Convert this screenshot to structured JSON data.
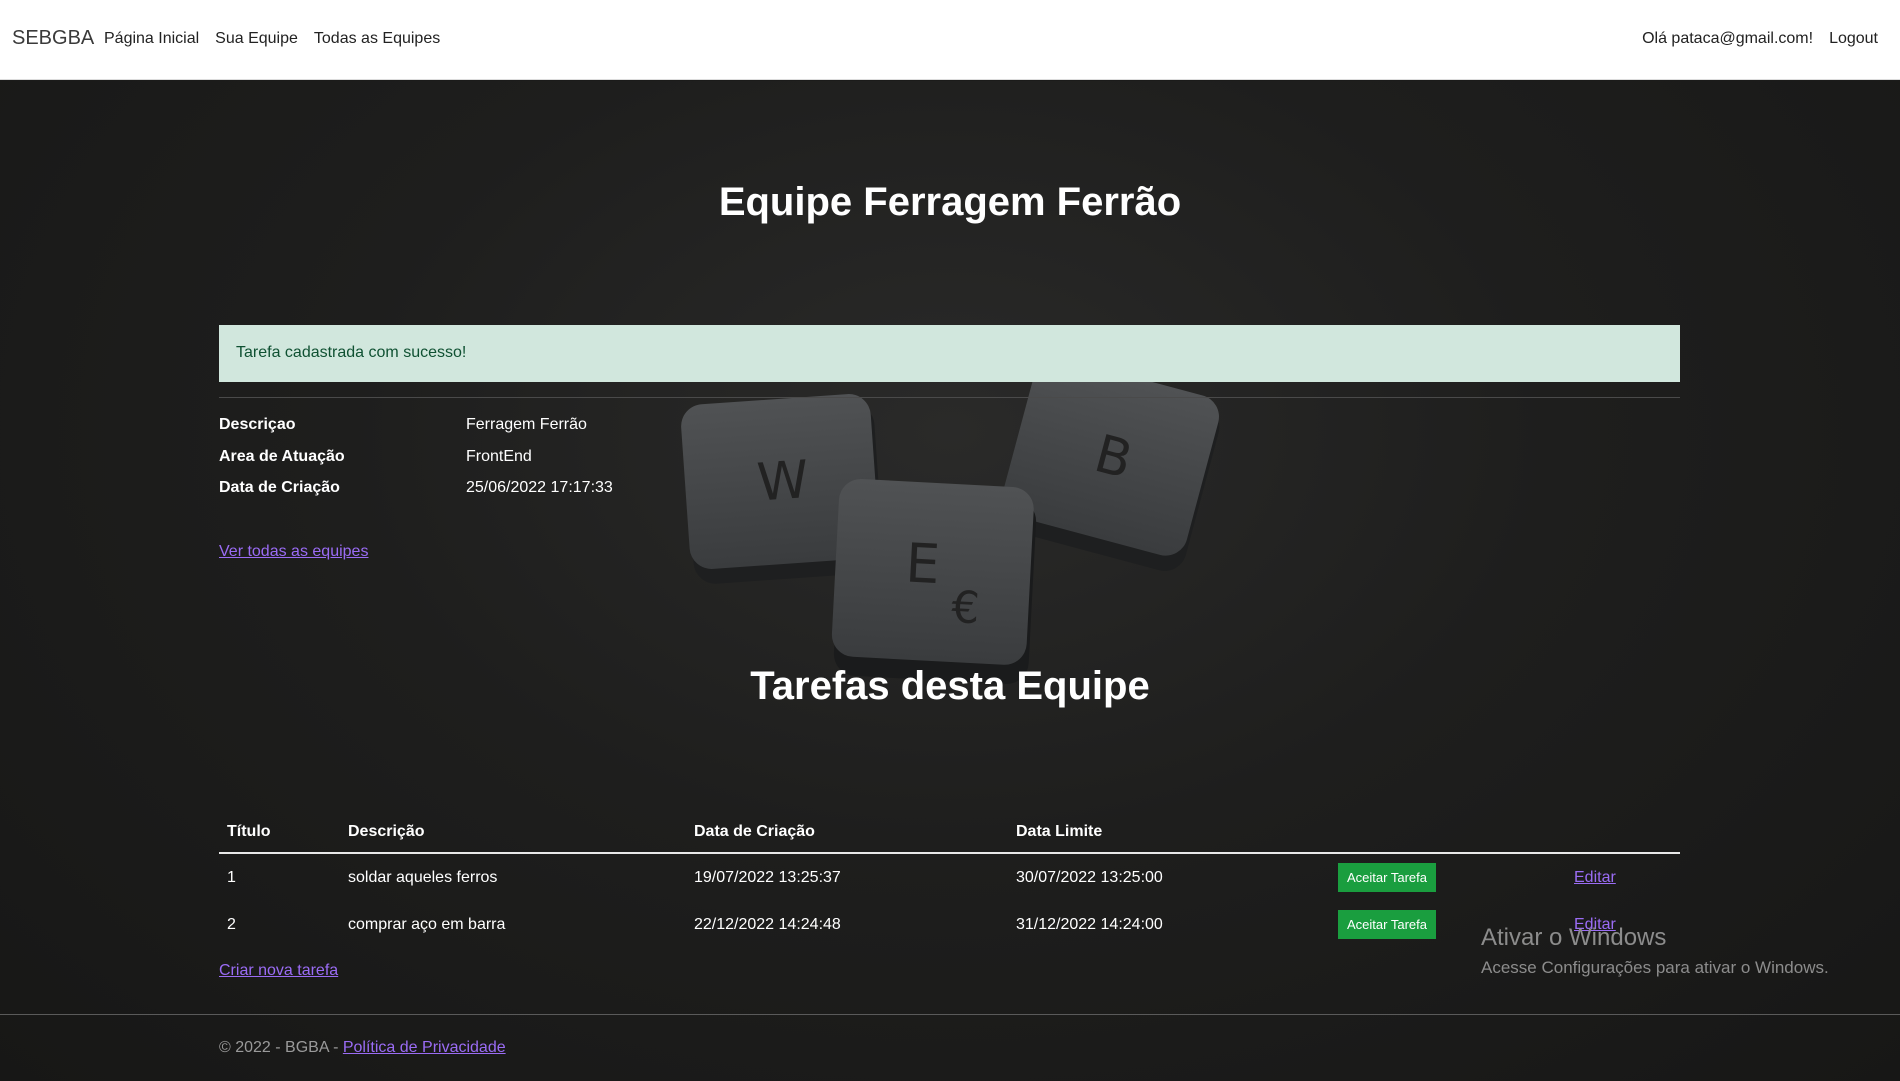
{
  "nav": {
    "brand": "SEBGBA",
    "links": [
      "Página Inicial",
      "Sua Equipe",
      "Todas as Equipes"
    ],
    "greeting": "Olá pataca@gmail.com!",
    "logout": "Logout"
  },
  "page": {
    "title": "Equipe Ferragem Ferrão",
    "alert": "Tarefa cadastrada com sucesso!",
    "details": [
      {
        "label": "Descriçao",
        "value": "Ferragem Ferrão"
      },
      {
        "label": "Area de Atuação",
        "value": "FrontEnd"
      },
      {
        "label": "Data de Criação",
        "value": "25/06/2022 17:17:33"
      }
    ],
    "see_all_link": "Ver todas as equipes",
    "tasks_title": "Tarefas desta Equipe",
    "background_keys": [
      "W",
      "B",
      "E",
      "€"
    ]
  },
  "tasks": {
    "columns": [
      "Título",
      "Descrição",
      "Data de Criação",
      "Data Limite"
    ],
    "rows": [
      {
        "id": "1",
        "description": "soldar aqueles ferros",
        "created": "19/07/2022 13:25:37",
        "deadline": "30/07/2022 13:25:00",
        "accept": "Aceitar Tarefa",
        "edit": "Editar"
      },
      {
        "id": "2",
        "description": "comprar aço em barra",
        "created": "22/12/2022 14:24:48",
        "deadline": "31/12/2022 14:24:00",
        "accept": "Aceitar Tarefa",
        "edit": "Editar"
      }
    ],
    "create_link": "Criar nova tarefa"
  },
  "windows_watermark": {
    "title": "Ativar o Windows",
    "subtitle": "Acesse Configurações para ativar o Windows."
  },
  "footer": {
    "copyright": "© 2022 - BGBA -",
    "privacy_link": "Política de Privacidade"
  },
  "colors": {
    "accent_link": "#9b6cf5",
    "success_bg": "#d1e7dd",
    "success_text": "#0f5132",
    "button_green": "#1a9e3f",
    "background": "#1b1b1a"
  }
}
